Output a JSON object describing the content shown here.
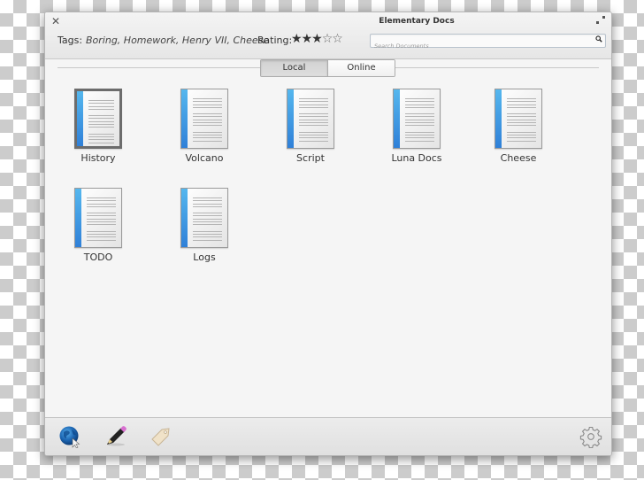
{
  "window": {
    "title": "Elementary Docs"
  },
  "header": {
    "tags_label": "Tags:",
    "tags_value": "Boring, Homework, Henry VII, Cheese",
    "rating_label": "Rating:",
    "rating": {
      "value": 3,
      "max": 5
    },
    "search": {
      "placeholder": "Search Documents",
      "value": ""
    }
  },
  "tabs": [
    {
      "label": "Local",
      "active": true
    },
    {
      "label": "Online",
      "active": false
    }
  ],
  "documents": [
    {
      "name": "History",
      "selected": true
    },
    {
      "name": "Volcano",
      "selected": false
    },
    {
      "name": "Script",
      "selected": false
    },
    {
      "name": "Luna Docs",
      "selected": false
    },
    {
      "name": "Cheese",
      "selected": false
    },
    {
      "name": "TODO",
      "selected": false
    },
    {
      "name": "Logs",
      "selected": false
    }
  ],
  "toolbar": {
    "buttons": [
      {
        "icon": "globe-icon"
      },
      {
        "icon": "pencil-icon"
      },
      {
        "icon": "tag-icon"
      }
    ],
    "settings_icon": "gear-icon"
  },
  "colors": {
    "accent_blue": "#2f80d8",
    "spine_light": "#55b7ee"
  }
}
